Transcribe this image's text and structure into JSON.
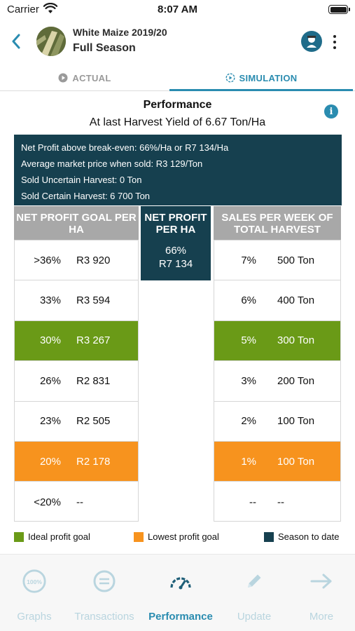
{
  "status_bar": {
    "carrier": "Carrier",
    "time": "8:07 AM"
  },
  "header": {
    "crop": "White Maize 2019/20",
    "season": "Full Season"
  },
  "tabs": [
    {
      "label": "ACTUAL",
      "icon": "play-circle-icon",
      "active": false
    },
    {
      "label": "SIMULATION",
      "icon": "simulation-icon",
      "active": true
    }
  ],
  "performance": {
    "title": "Performance",
    "subtitle": "At last Harvest Yield of 6.67 Ton/Ha"
  },
  "summary": [
    "Net Profit above break-even: 66%/Ha or R7 134/Ha",
    "Average market price when sold: R3 129/Ton",
    "Sold Uncertain Harvest: 0 Ton",
    "Sold Certain Harvest: 6 700 Ton"
  ],
  "columns": {
    "left": "NET PROFIT GOAL PER HA",
    "mid": "NET PROFIT PER HA",
    "right": "SALES PER WEEK OF TOTAL HARVEST"
  },
  "net_profit": {
    "percent": "66%",
    "amount": "R7 134"
  },
  "profit_goals": [
    {
      "percent": ">36%",
      "amount": "R3 920",
      "highlight": ""
    },
    {
      "percent": "33%",
      "amount": "R3 594",
      "highlight": ""
    },
    {
      "percent": "30%",
      "amount": "R3 267",
      "highlight": "green"
    },
    {
      "percent": "26%",
      "amount": "R2 831",
      "highlight": ""
    },
    {
      "percent": "23%",
      "amount": "R2 505",
      "highlight": ""
    },
    {
      "percent": "20%",
      "amount": "R2 178",
      "highlight": "orange"
    },
    {
      "percent": "<20%",
      "amount": "--",
      "highlight": ""
    }
  ],
  "sales_per_week": [
    {
      "percent": "7%",
      "amount": "500 Ton",
      "highlight": ""
    },
    {
      "percent": "6%",
      "amount": "400 Ton",
      "highlight": ""
    },
    {
      "percent": "5%",
      "amount": "300 Ton",
      "highlight": "green"
    },
    {
      "percent": "3%",
      "amount": "200 Ton",
      "highlight": ""
    },
    {
      "percent": "2%",
      "amount": "100 Ton",
      "highlight": ""
    },
    {
      "percent": "1%",
      "amount": "100 Ton",
      "highlight": "orange"
    },
    {
      "percent": "--",
      "amount": "--",
      "highlight": ""
    }
  ],
  "legend": [
    {
      "label": "Ideal profit goal",
      "color": "#6a9a17"
    },
    {
      "label": "Lowest profit goal",
      "color": "#f7931e"
    },
    {
      "label": "Season to date",
      "color": "#16404f"
    }
  ],
  "nav": [
    {
      "label": "Graphs",
      "icon": "graphs-icon",
      "active": false
    },
    {
      "label": "Transactions",
      "icon": "transactions-icon",
      "active": false
    },
    {
      "label": "Performance",
      "icon": "gauge-icon",
      "active": true
    },
    {
      "label": "Update",
      "icon": "pencil-icon",
      "active": false
    },
    {
      "label": "More",
      "icon": "arrow-right-icon",
      "active": false
    }
  ],
  "colors": {
    "accent": "#2a8cb0",
    "dark": "#16404f",
    "green": "#6a9a17",
    "orange": "#f7931e",
    "grey_header": "#a8a8a8"
  }
}
